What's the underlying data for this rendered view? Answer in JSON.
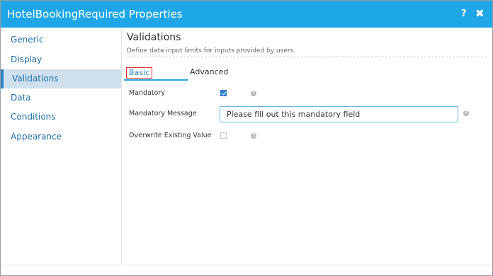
{
  "dialog": {
    "title": "HotelBookingRequired Properties",
    "help_label": "?",
    "close_label": "✖",
    "accent_color": "#1ea7e8"
  },
  "sidebar": {
    "items": [
      {
        "label": "Generic",
        "active": false
      },
      {
        "label": "Display",
        "active": false
      },
      {
        "label": "Validations",
        "active": true
      },
      {
        "label": "Data",
        "active": false
      },
      {
        "label": "Conditions",
        "active": false
      },
      {
        "label": "Appearance",
        "active": false
      }
    ]
  },
  "section": {
    "title": "Validations",
    "description": "Define data input limits for inputs provided by users."
  },
  "tabs": [
    {
      "label": "Basic",
      "selected": true
    },
    {
      "label": "Advanced",
      "selected": false
    }
  ],
  "fields": {
    "mandatory": {
      "label": "Mandatory",
      "checked": true,
      "help_icon": "question-circle-icon"
    },
    "mandatory_message": {
      "label": "Mandatory Message",
      "value": "Please fill out this mandatory field",
      "help_icon": "question-circle-icon"
    },
    "overwrite_existing_value": {
      "label": "Overwrite Existing Value",
      "checked": false,
      "help_icon": "question-circle-icon"
    }
  }
}
